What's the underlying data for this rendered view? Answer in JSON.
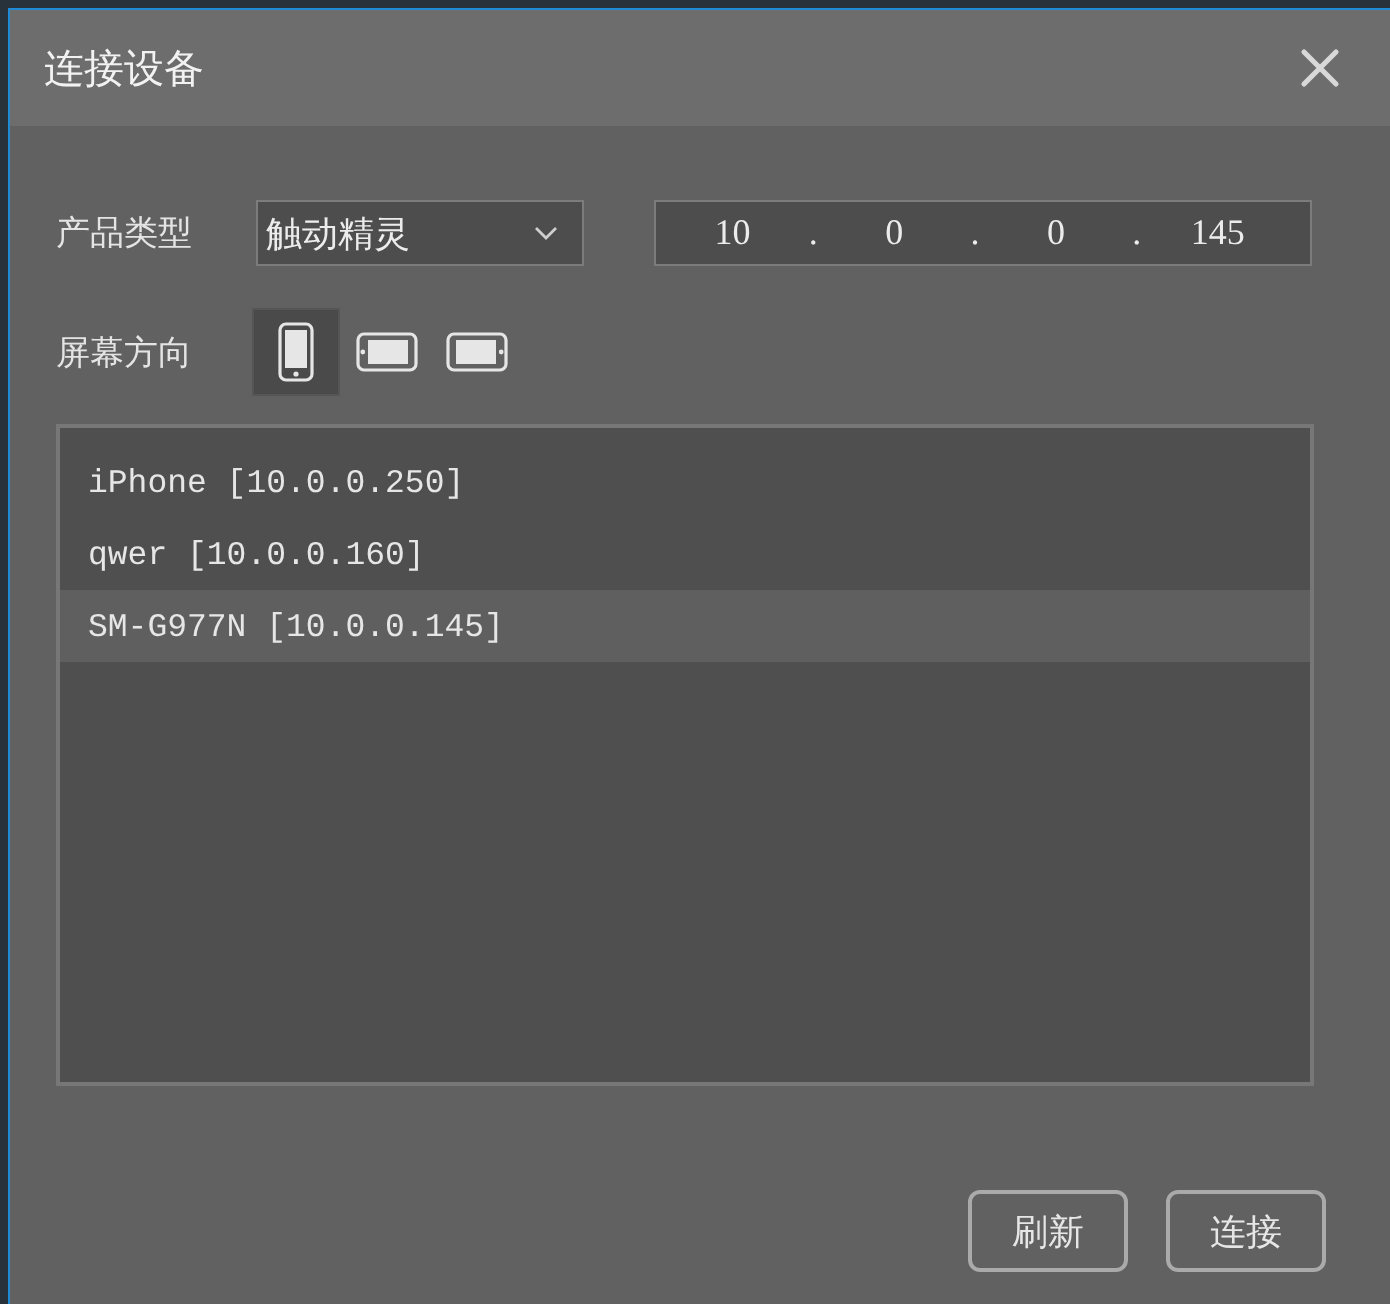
{
  "window": {
    "title": "连接设备"
  },
  "product_type": {
    "label": "产品类型",
    "value": "触动精灵"
  },
  "ip_address": {
    "octets": [
      "10",
      "0",
      "0",
      "145"
    ],
    "separators": [
      ".",
      ".",
      "."
    ]
  },
  "screen_orientation": {
    "label": "屏幕方向",
    "options": [
      {
        "kind": "portrait",
        "selected": true
      },
      {
        "kind": "landscape-left",
        "selected": false
      },
      {
        "kind": "landscape-right",
        "selected": false
      }
    ]
  },
  "devices": [
    {
      "name": "iPhone [10.0.0.250]",
      "selected": false
    },
    {
      "name": "qwer [10.0.0.160]",
      "selected": false
    },
    {
      "name": "SM-G977N [10.0.0.145]",
      "selected": true
    }
  ],
  "buttons": [
    "刷新",
    "连接"
  ]
}
